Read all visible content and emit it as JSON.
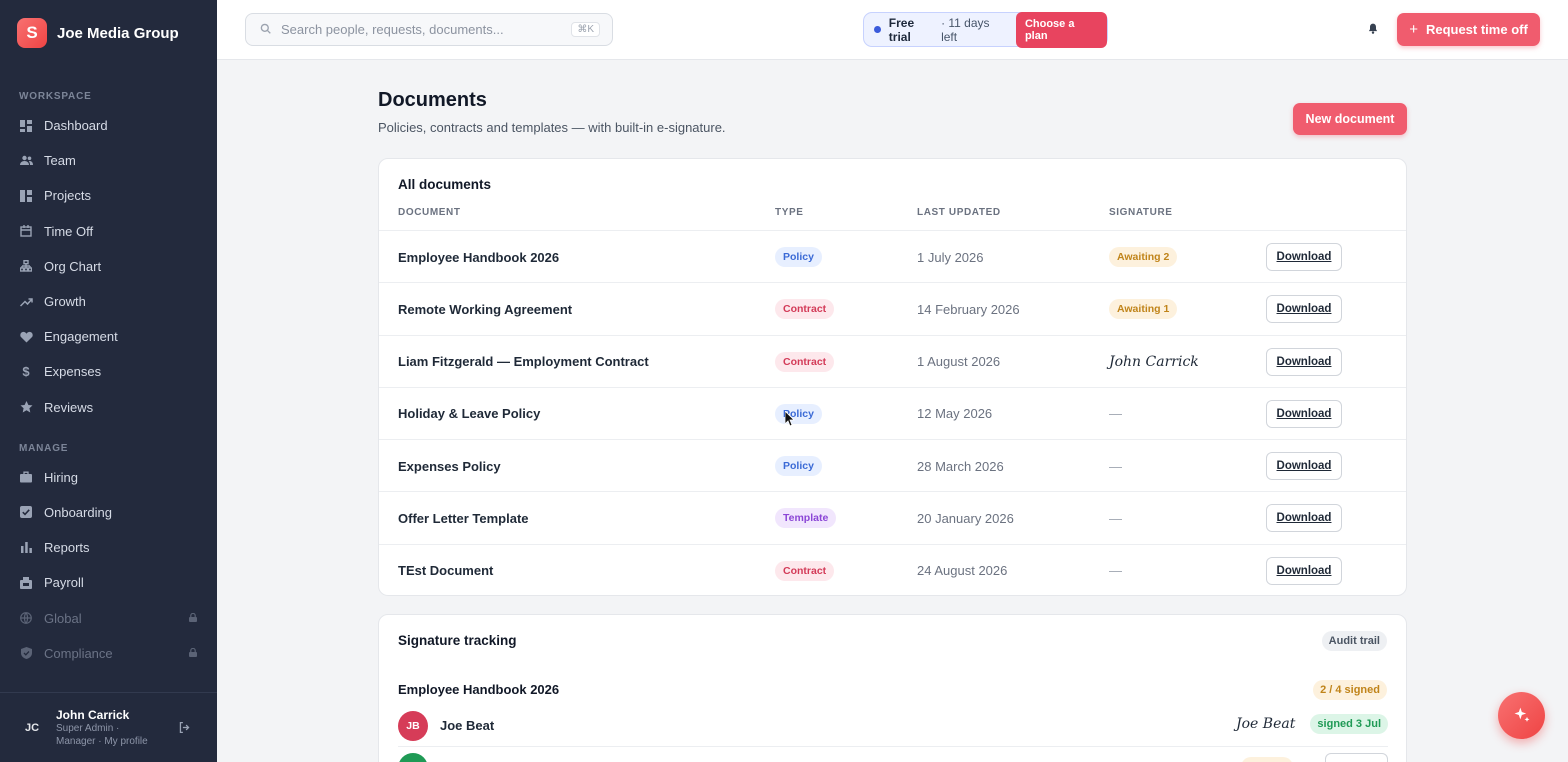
{
  "brand": {
    "name": "Joe Media Group",
    "logo_letter": "S"
  },
  "sidebar": {
    "workspace_label": "WORKSPACE",
    "workspace_items": [
      {
        "label": "Dashboard",
        "icon": "dashboard-icon"
      },
      {
        "label": "Team",
        "icon": "team-icon"
      },
      {
        "label": "Projects",
        "icon": "projects-icon"
      },
      {
        "label": "Time Off",
        "icon": "calendar-icon"
      },
      {
        "label": "Org Chart",
        "icon": "org-chart-icon"
      },
      {
        "label": "Growth",
        "icon": "growth-icon"
      },
      {
        "label": "Engagement",
        "icon": "heart-icon"
      },
      {
        "label": "Expenses",
        "icon": "dollar-icon"
      },
      {
        "label": "Reviews",
        "icon": "star-icon"
      }
    ],
    "manage_label": "MANAGE",
    "manage_items": [
      {
        "label": "Hiring",
        "icon": "briefcase-icon"
      },
      {
        "label": "Onboarding",
        "icon": "checkbox-icon"
      },
      {
        "label": "Reports",
        "icon": "bar-chart-icon"
      },
      {
        "label": "Payroll",
        "icon": "payroll-icon"
      },
      {
        "label": "Global",
        "icon": "globe-icon",
        "locked": true
      },
      {
        "label": "Compliance",
        "icon": "shield-icon",
        "locked": true
      }
    ]
  },
  "profile": {
    "initials": "JC",
    "name": "John Carrick",
    "role_line1": "Super Admin ·",
    "role_line2": "Manager · My profile"
  },
  "topbar": {
    "search_placeholder": "Search people, requests, documents...",
    "search_shortcut": "⌘K",
    "trial_bold": "Free trial",
    "trial_text": "· 11 days left",
    "choose_plan": "Choose a plan",
    "request_time_off": "Request time off"
  },
  "page": {
    "title": "Documents",
    "subtitle": "Policies, contracts and templates — with built-in e-signature.",
    "new_document": "New document"
  },
  "documents": {
    "card_title": "All documents",
    "columns": [
      "DOCUMENT",
      "TYPE",
      "LAST UPDATED",
      "SIGNATURE"
    ],
    "download_label": "Download",
    "rows": [
      {
        "name": "Employee Handbook 2026",
        "type": "Policy",
        "updated": "1 July 2026",
        "signature": "Awaiting 2",
        "signature_kind": "awaiting"
      },
      {
        "name": "Remote Working Agreement",
        "type": "Contract",
        "updated": "14 February 2026",
        "signature": "Awaiting 1",
        "signature_kind": "awaiting"
      },
      {
        "name": "Liam Fitzgerald — Employment Contract",
        "type": "Contract",
        "updated": "1 August 2026",
        "signature": "John Carrick",
        "signature_kind": "signed"
      },
      {
        "name": "Holiday & Leave Policy",
        "type": "Policy",
        "updated": "12 May 2026",
        "signature": "—",
        "signature_kind": "none"
      },
      {
        "name": "Expenses Policy",
        "type": "Policy",
        "updated": "28 March 2026",
        "signature": "—",
        "signature_kind": "none"
      },
      {
        "name": "Offer Letter Template",
        "type": "Template",
        "updated": "20 January 2026",
        "signature": "—",
        "signature_kind": "none"
      },
      {
        "name": "TEst Document",
        "type": "Contract",
        "updated": "24 August 2026",
        "signature": "—",
        "signature_kind": "none"
      }
    ]
  },
  "signature_tracking": {
    "title": "Signature tracking",
    "audit_trail": "Audit trail",
    "document": "Employee Handbook 2026",
    "signed_count": "2 / 4 signed",
    "signer": {
      "initials": "JB",
      "name": "Joe Beat",
      "signature": "Joe Beat",
      "status": "signed 3 Jul"
    }
  }
}
